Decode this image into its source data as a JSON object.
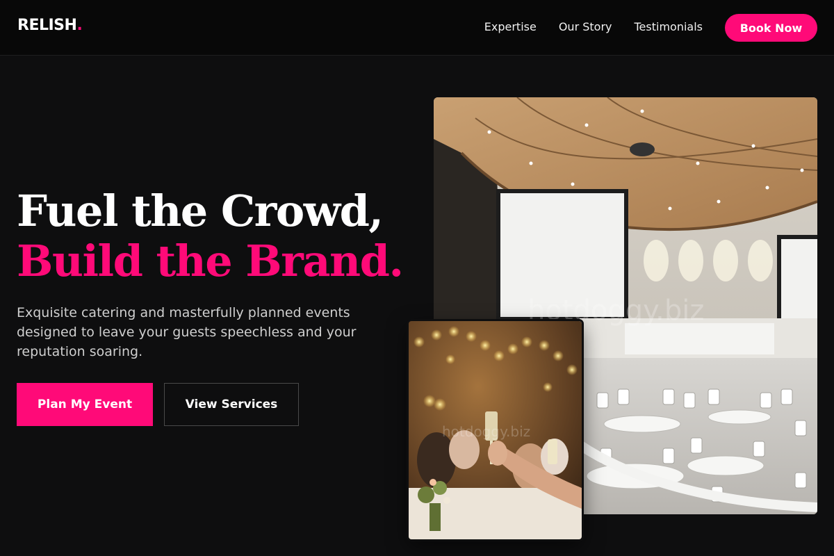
{
  "brand": {
    "name": "RELISH",
    "dot": ".",
    "accent": "#ff0a78"
  },
  "nav": {
    "links": [
      "Expertise",
      "Our Story",
      "Testimonials"
    ],
    "cta_label": "Book Now"
  },
  "hero": {
    "headline_line1": "Fuel the Crowd,",
    "headline_line2": "Build the Brand.",
    "subtext": "Exquisite catering and masterfully planned events designed to leave your guests speechless and your reputation soaring.",
    "primary_button": "Plan My Event",
    "secondary_button": "View Services"
  },
  "images": {
    "main": "conference-hall-photo",
    "secondary": "celebration-toast-photo"
  },
  "watermark": "hotdoggy.biz"
}
